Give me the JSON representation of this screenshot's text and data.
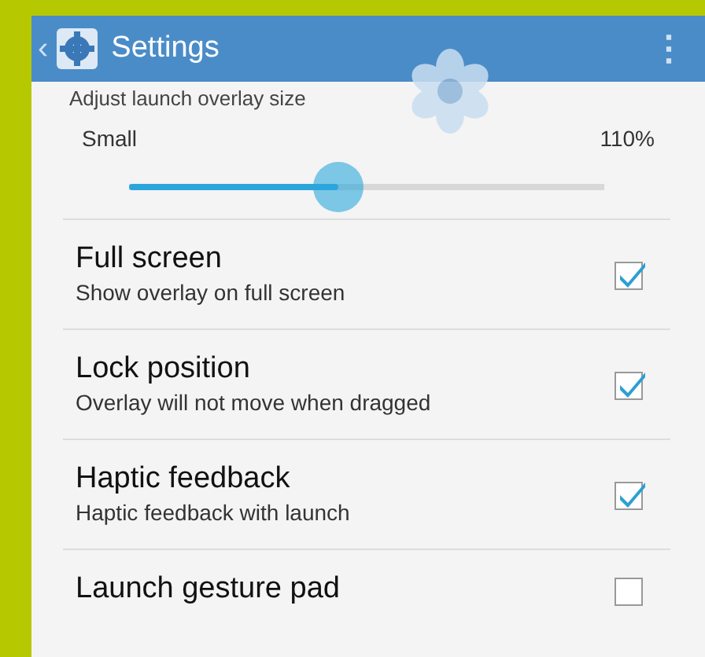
{
  "action_bar": {
    "back": "‹",
    "title": "Settings",
    "menu": "⋮"
  },
  "size_section": {
    "heading": "Adjust launch overlay size",
    "slider_label": "Small",
    "reading": "110%",
    "level": 0.44
  },
  "settings": [
    {
      "title": "Full screen",
      "subtitle": "Show overlay on full screen",
      "checked": true
    },
    {
      "title": "Lock position",
      "subtitle": "Overlay will not move when dragged",
      "checked": true
    },
    {
      "title": "Haptic feedback",
      "subtitle": "Haptic feedback with launch",
      "checked": true
    },
    {
      "title": "Launch gesture pad",
      "checked": false
    }
  ]
}
